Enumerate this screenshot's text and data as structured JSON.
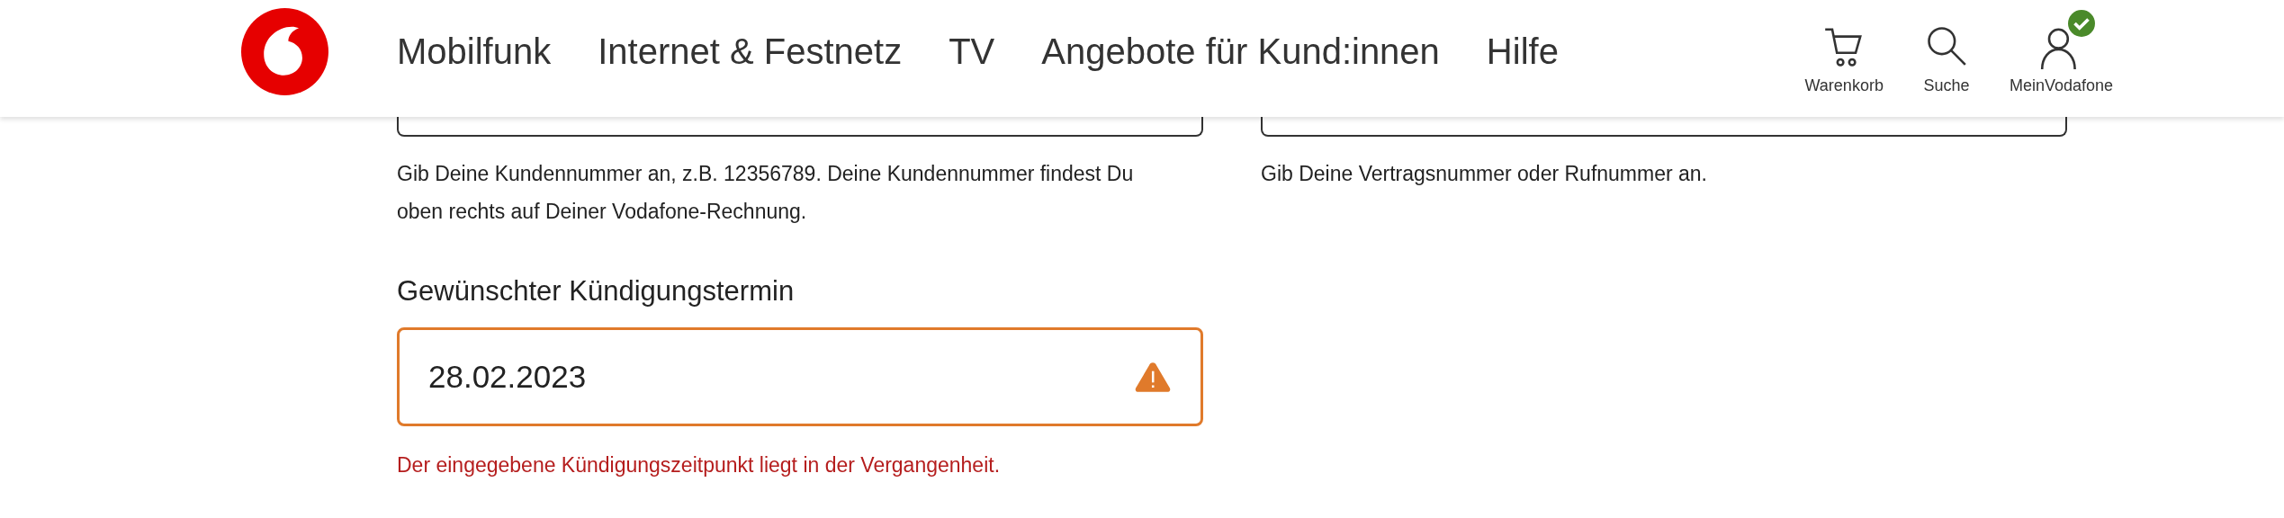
{
  "header": {
    "nav": [
      {
        "label": "Mobilfunk"
      },
      {
        "label": "Internet & Festnetz"
      },
      {
        "label": "TV"
      },
      {
        "label": "Angebote für Kund:innen"
      },
      {
        "label": "Hilfe"
      }
    ],
    "actions": [
      {
        "kind": "cart",
        "label": "Warenkorb"
      },
      {
        "kind": "search",
        "label": "Suche"
      },
      {
        "kind": "account",
        "label": "MeinVodafone",
        "logged_in": true
      }
    ]
  },
  "top_fields": [
    {
      "hint": "Gib Deine Kundennummer an, z.B. 12356789. Deine Kundennummer findest Du oben rechts auf Deiner Vodafone-Rechnung."
    },
    {
      "hint": "Gib Deine Vertragsnummer oder Rufnummer an."
    }
  ],
  "date_field": {
    "label": "Gewünschter Kündigungstermin",
    "value": "28.02.2023",
    "invalid": true,
    "error": "Der eingegebene Kündigungszeitpunkt liegt in der Vergangenheit."
  }
}
